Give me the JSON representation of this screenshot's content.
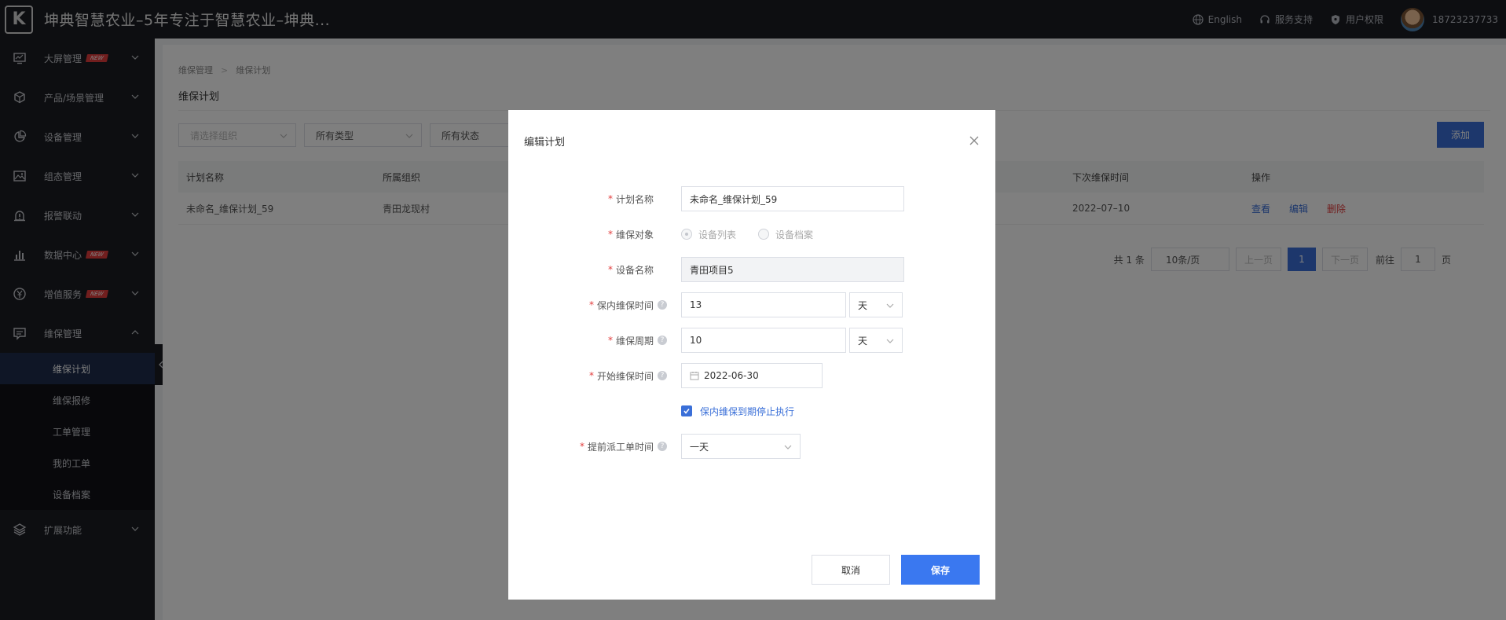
{
  "header": {
    "logo_letter": "K",
    "title": "坤典智慧农业–5年专注于智慧农业–坤典...",
    "language": "English",
    "support": "服务支持",
    "permissions": "用户权限",
    "phone": "18723237733"
  },
  "sidebar": {
    "items": [
      {
        "label": "大屏管理",
        "icon": "monitor-icon",
        "badge": "NEW"
      },
      {
        "label": "产品/场景管理",
        "icon": "cube-icon"
      },
      {
        "label": "设备管理",
        "icon": "pie-chart-icon"
      },
      {
        "label": "组态管理",
        "icon": "image-icon"
      },
      {
        "label": "报警联动",
        "icon": "alarm-icon"
      },
      {
        "label": "数据中心",
        "icon": "bar-chart-icon",
        "badge": "NEW"
      },
      {
        "label": "增值服务",
        "icon": "yen-icon",
        "badge": "NEW"
      },
      {
        "label": "维保管理",
        "icon": "message-icon"
      },
      {
        "label": "扩展功能",
        "icon": "layers-icon"
      }
    ],
    "sub_items": [
      "维保计划",
      "维保报修",
      "工单管理",
      "我的工单",
      "设备档案"
    ]
  },
  "page": {
    "breadcrumb": [
      "维保管理",
      "维保计划"
    ],
    "title": "维保计划",
    "filters": {
      "org_placeholder": "请选择组织",
      "type": "所有类型",
      "status": "所有状态"
    },
    "add_label": "添加",
    "table": {
      "headers": [
        "计划名称",
        "所属组织",
        "下次维保时间",
        "操作"
      ],
      "rows": [
        {
          "name": "未命名_维保计划_59",
          "org": "青田龙现村",
          "next": "2022–07–10"
        }
      ],
      "actions": {
        "view": "查看",
        "edit": "编辑",
        "delete": "删除"
      }
    },
    "pager": {
      "total": "共 1 条",
      "page_size": "10条/页",
      "prev": "上一页",
      "current": "1",
      "next": "下一页",
      "goto": "前往",
      "goto_value": "1",
      "page_unit": "页"
    }
  },
  "modal": {
    "title": "编辑计划",
    "fields": {
      "plan_name": {
        "label": "计划名称",
        "value": "未命名_维保计划_59"
      },
      "target": {
        "label": "维保对象",
        "options": [
          "设备列表",
          "设备档案"
        ]
      },
      "device_name": {
        "label": "设备名称",
        "value": "青田项目5"
      },
      "warranty_time": {
        "label": "保内维保时间",
        "value": "13",
        "unit": "天"
      },
      "cycle": {
        "label": "维保周期",
        "value": "10",
        "unit": "天"
      },
      "start_time": {
        "label": "开始维保时间",
        "value": "2022-06-30"
      },
      "stop_checkbox": {
        "label": "保内维保到期停止执行",
        "checked": true
      },
      "advance": {
        "label": "提前派工单时间",
        "value": "一天"
      }
    },
    "cancel": "取消",
    "save": "保存"
  }
}
